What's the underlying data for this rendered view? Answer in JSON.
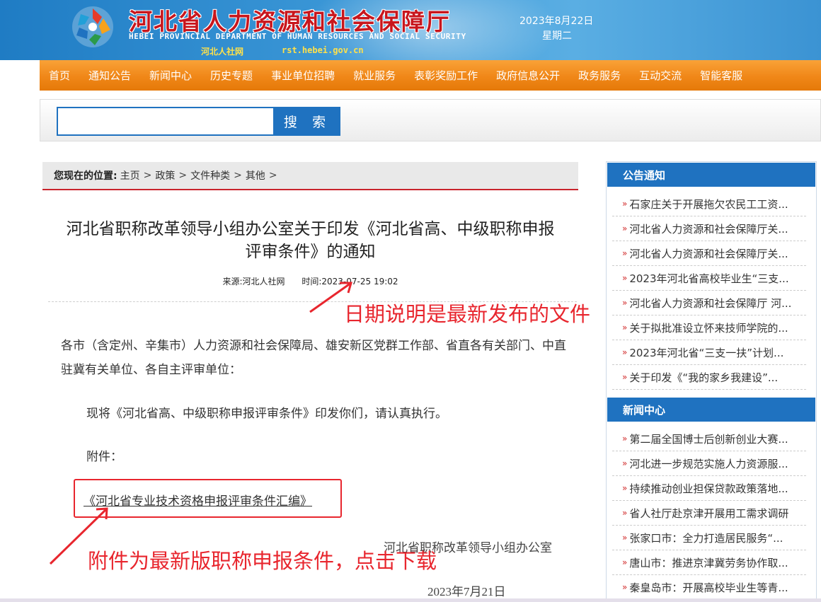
{
  "header": {
    "title": "河北省人力资源和社会保障厅",
    "title_en": "HEBEI PROVINCIAL DEPARTMENT OF HUMAN RESOURCES AND SOCIAL SECURITY",
    "short_name": "河北人社网",
    "url": "rst.hebei.gov.cn",
    "date": "2023年8月22日",
    "weekday": "星期二"
  },
  "nav": [
    "首页",
    "通知公告",
    "新闻中心",
    "历史专题",
    "事业单位招聘",
    "就业服务",
    "表彰奖励工作",
    "政府信息公开",
    "政务服务",
    "互动交流",
    "智能客服"
  ],
  "search": {
    "placeholder": "",
    "button_label": "搜 索"
  },
  "breadcrumb": {
    "label": "您现在的位置:",
    "items": [
      "主页",
      "政策",
      "文件种类",
      "其他"
    ],
    "sep": ">"
  },
  "article": {
    "title_line1": "河北省职称改革领导小组办公室关于印发《河北省高、中级职称申报",
    "title_line2": "评审条件》的通知",
    "source": "来源:河北人社网",
    "time": "时间:2023-07-25 19:02",
    "addressee": "各市（含定州、辛集市）人力资源和社会保障局、雄安新区党群工作部、省直各有关部门、中直驻冀有关单位、各自主评审单位：",
    "para1": "现将《河北省高、中级职称申报评审条件》印发你们，请认真执行。",
    "attach_label": "附件：",
    "attach_link": "《河北省专业技术资格申报评审条件汇编》",
    "signature": "河北省职称改革领导小组办公室",
    "sign_date": "2023年7月21日"
  },
  "annotations": {
    "date_note": "日期说明是最新发布的文件",
    "attach_note": "附件为最新版职称申报条件，点击下载",
    "color": "#e8262e"
  },
  "sidebar": {
    "notice_title": "公告通知",
    "notice_items": [
      "石家庄关于开展拖欠农民工工资...",
      "河北省人力资源和社会保障厅关...",
      "河北省人力资源和社会保障厅关...",
      "2023年河北省高校毕业生“三支...",
      "河北省人力资源和社会保障厅 河...",
      "关于拟批准设立怀来技师学院的...",
      "2023年河北省“三支一扶”计划...",
      "关于印发《“我的家乡我建设”..."
    ],
    "news_title": "新闻中心",
    "news_items": [
      "第二届全国博士后创新创业大赛...",
      "河北进一步规范实施人力资源服...",
      "持续推动创业担保贷款政策落地...",
      "省人社厅赴京津开展用工需求调研",
      "张家口市：全力打造居民服务“...",
      "唐山市：推进京津冀劳务协作取...",
      "秦皇岛市：开展高校毕业生等青..."
    ]
  },
  "colors": {
    "nav": "#f08718",
    "brand_blue": "#1f72c0",
    "title_red": "#c8161d"
  }
}
